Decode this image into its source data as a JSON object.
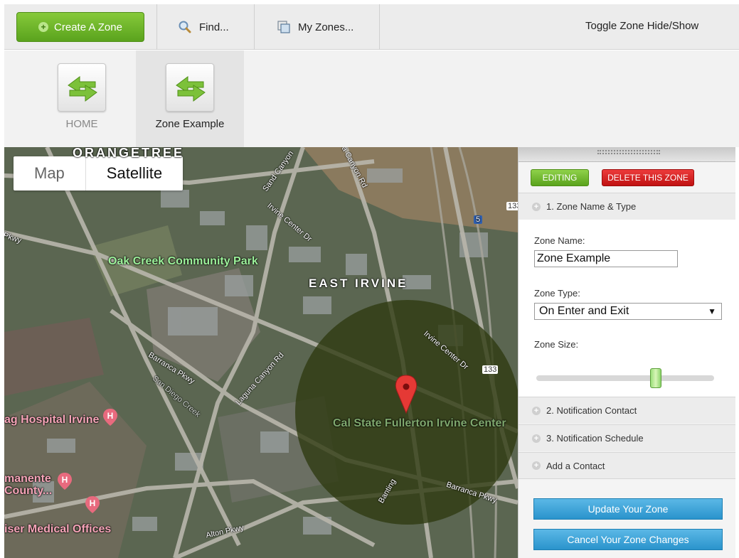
{
  "toolbar": {
    "create_label": "Create A Zone",
    "find_label": "Find...",
    "myzones_label": "My Zones...",
    "toggle_label": "Toggle Zone Hide/Show"
  },
  "zone_tabs": [
    {
      "label": "HOME",
      "active": false
    },
    {
      "label": "Zone Example",
      "active": true
    }
  ],
  "map": {
    "type_options": [
      "Map",
      "Satellite"
    ],
    "selected_type": "Satellite",
    "labels": {
      "orangetree": "ORANGETREE",
      "oak_creek": "Oak Creek Community Park",
      "east_irvine": "EAST IRVINE",
      "cal_state": "Cal State Fullerton Irvine Center",
      "hospital": "ag Hospital Irvine",
      "kaiser_county": "manente County...",
      "kaiser_offices": "iser Medical Offices",
      "pkwy_left": "Pkwy",
      "sand_canyon": "Sand Canyon",
      "laguna_canyon_top": "a Canyon Rd",
      "irvine_center_top": "Irvine Center Dr",
      "irvine_center_mid": "Irvine Center Dr",
      "barranca_left": "Barranca Pkwy",
      "san_diego_creek": "San Diego Creek",
      "laguna_canyon_mid": "Laguna Canyon Rd",
      "barranca_right": "Barranca Pkwy",
      "alton": "Alton Pkwy",
      "banting": "Banting",
      "route_5": "5",
      "route_133_top": "133",
      "route_133_mid": "133"
    }
  },
  "panel": {
    "editing_label": "EDITING",
    "delete_label": "DELETE THIS ZONE",
    "section1": "1. Zone Name & Type",
    "zone_name_label": "Zone Name:",
    "zone_name_value": "Zone Example",
    "zone_type_label": "Zone Type:",
    "zone_type_value": "On Enter and Exit",
    "zone_size_label": "Zone Size:",
    "section2": "2. Notification Contact",
    "section3": "3. Notification Schedule",
    "section4": "Add a Contact",
    "update_label": "Update Your Zone",
    "cancel_label": "Cancel Your Zone Changes"
  },
  "colors": {
    "green_button": "#5aa31d",
    "red_button": "#c01212",
    "blue_button": "#2a93cc",
    "zone_circle": "#2e3a10"
  }
}
